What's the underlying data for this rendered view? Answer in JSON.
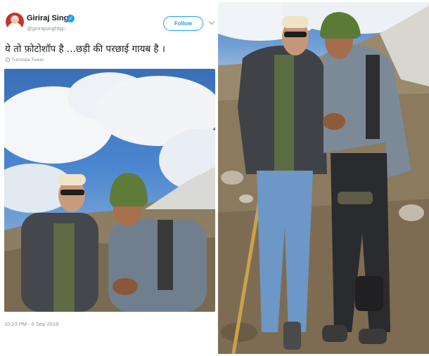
{
  "tweet": {
    "author_name": "Giriraj Singh",
    "author_handle": "@girirajsinghbjp",
    "follow_label": "Follow",
    "text": "ये तो फ़ोटोशॉप है ...छड़ी की परछाई गायब है ।",
    "translate_label": "Translate Tweet",
    "timestamp": "10:23 PM - 6 Sep 2018"
  },
  "icons": {
    "verified": "verified-badge-icon",
    "menu": "chevron-down-icon",
    "translate": "globe-icon"
  },
  "colors": {
    "twitter_blue": "#1da1f2",
    "text_primary": "#14171a",
    "text_secondary": "#8a949c"
  }
}
